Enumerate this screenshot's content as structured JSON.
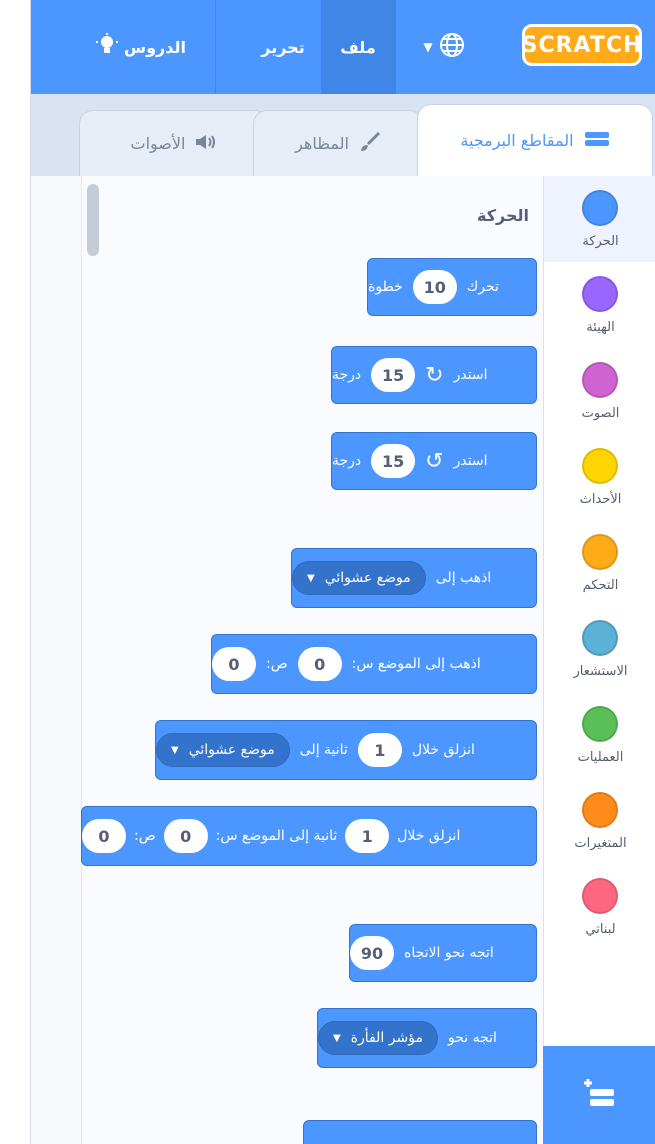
{
  "menu": {
    "logo": "SCRATCH",
    "language_icon": "globe-icon",
    "file_label": "ملف",
    "edit_label": "تحرير",
    "tutorials_label": "الدروس"
  },
  "tabs": [
    {
      "label": "المقاطع البرمجية",
      "icon": "code-icon"
    },
    {
      "label": "المظاهر",
      "icon": "brush-icon"
    },
    {
      "label": "الأصوات",
      "icon": "speaker-icon"
    }
  ],
  "categories": [
    {
      "label": "الحركة",
      "color": "#4c97ff"
    },
    {
      "label": "الهيئة",
      "color": "#9966ff"
    },
    {
      "label": "الصوت",
      "color": "#cf63cf"
    },
    {
      "label": "الأحداث",
      "color": "#ffd500"
    },
    {
      "label": "التحكم",
      "color": "#ffab19"
    },
    {
      "label": "الاستشعار",
      "color": "#5cb1d6"
    },
    {
      "label": "العمليات",
      "color": "#59c059"
    },
    {
      "label": "المتغيرات",
      "color": "#ff8c1a"
    },
    {
      "label": "لبناتي",
      "color": "#ff6680"
    }
  ],
  "palette": {
    "section_title": "الحركة",
    "blocks": {
      "move": {
        "text": "تحرك",
        "value": "10",
        "text2": "خطوة"
      },
      "turn_right": {
        "text": "استدر",
        "value": "15",
        "text2": "درجة"
      },
      "turn_left": {
        "text": "استدر",
        "value": "15",
        "text2": "درجة"
      },
      "goto": {
        "text": "اذهب إلى",
        "menu": "موضع عشوائي"
      },
      "goto_xy": {
        "text": "اذهب إلى الموضع س:",
        "x": "0",
        "text2": "ص:",
        "y": "0"
      },
      "glide_to": {
        "text": "انزلق خلال",
        "secs": "1",
        "text2": "ثانية إلى",
        "menu": "موضع عشوائي"
      },
      "glide_xy": {
        "text": "انزلق خلال",
        "secs": "1",
        "text2": "ثانية إلى الموضع س:",
        "x": "0",
        "text3": "ص:",
        "y": "0"
      },
      "point_dir": {
        "text": "اتجه نحو الاتجاه",
        "value": "90"
      },
      "point_towards": {
        "text": "اتجه نحو",
        "menu": "مؤشر الفأرة"
      }
    }
  }
}
